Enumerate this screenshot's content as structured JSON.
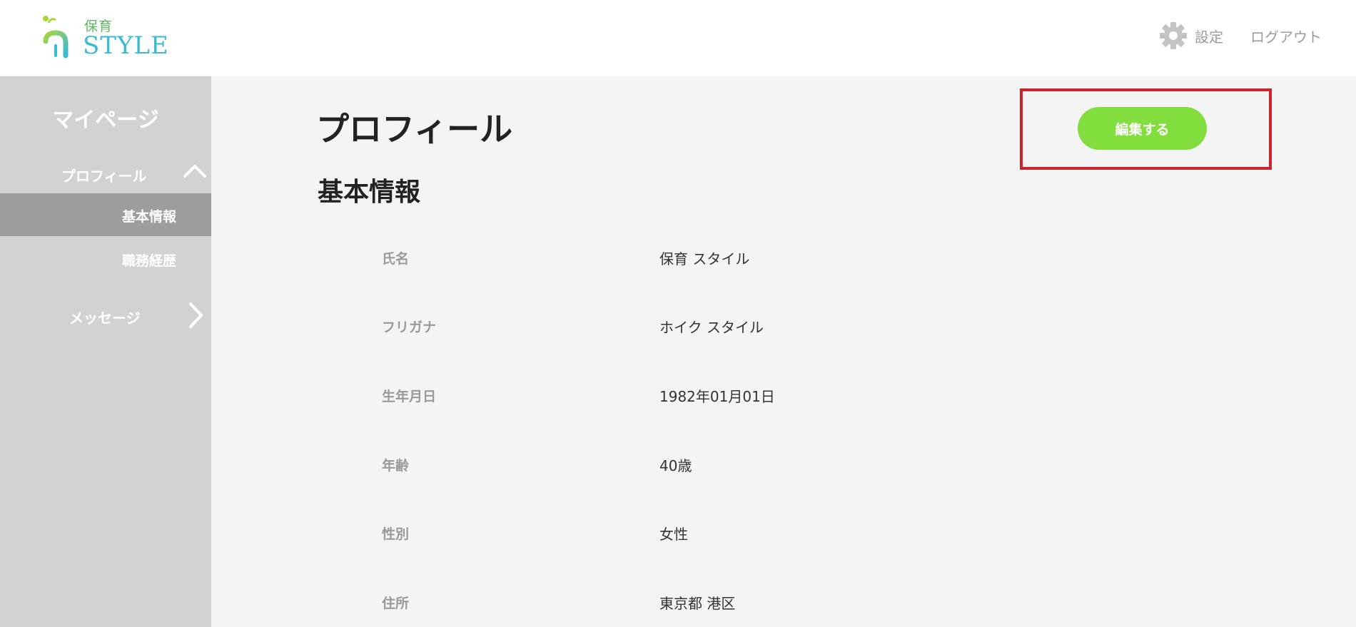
{
  "header": {
    "logo_small": "保育",
    "logo_main": "STYLE",
    "settings_label": "設定",
    "logout_label": "ログアウト"
  },
  "sidebar": {
    "title": "マイページ",
    "profile_label": "プロフィール",
    "basic_info_label": "基本情報",
    "career_label": "職務経歴",
    "messages_label": "メッセージ"
  },
  "main": {
    "page_title": "プロフィール",
    "section_title": "基本情報",
    "edit_button_label": "編集する",
    "rows": [
      {
        "label": "氏名",
        "value": "保育 スタイル"
      },
      {
        "label": "フリガナ",
        "value": "ホイク スタイル"
      },
      {
        "label": "生年月日",
        "value": "1982年01月01日"
      },
      {
        "label": "年齢",
        "value": "40歳"
      },
      {
        "label": "性別",
        "value": "女性"
      },
      {
        "label": "住所",
        "value": "東京都 港区"
      }
    ]
  },
  "colors": {
    "accent_green": "#82dd3e",
    "highlight_red": "#c9252c",
    "sidebar_bg": "#d2d2d2",
    "sidebar_active_bg": "#9d9d9d"
  }
}
